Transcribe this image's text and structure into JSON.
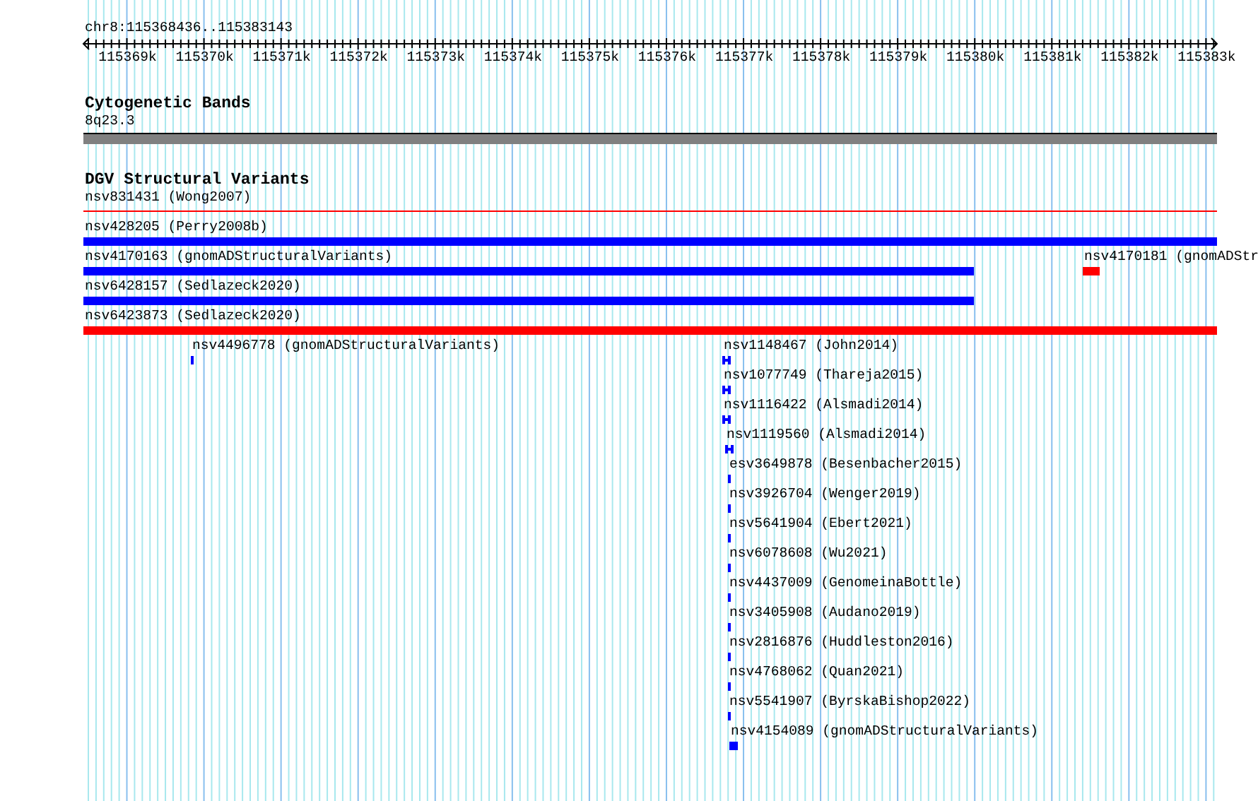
{
  "ruler": {
    "title": "chr8:115368436..115383143",
    "ticks": [
      "115369k",
      "115370k",
      "115371k",
      "115372k",
      "115373k",
      "115374k",
      "115375k",
      "115376k",
      "115377k",
      "115378k",
      "115379k",
      "115380k",
      "115381k",
      "115382k",
      "115383k"
    ]
  },
  "tracks": [
    {
      "kind": "cytoband",
      "title": "Cytogenetic Bands",
      "bands": [
        {
          "name": "8q23.3"
        }
      ]
    },
    {
      "kind": "features",
      "title": "DGV Structural Variants",
      "features": [
        {
          "label": "nsv831431 (Wong2007)",
          "kind": "line",
          "color": "#ff0000"
        },
        {
          "label": "nsv428205 (Perry2008b)",
          "kind": "bar",
          "color": "#0000ff"
        },
        {
          "label": "nsv4170163 (gnomADStructuralVariants)",
          "kind": "bar",
          "color": "#0000ff"
        },
        {
          "label": "nsv4170181 (gnomADStr",
          "kind": "bar",
          "color": "#ff0000"
        },
        {
          "label": "nsv6428157 (Sedlazeck2020)",
          "kind": "bar",
          "color": "#0000ff"
        },
        {
          "label": "nsv6423873 (Sedlazeck2020)",
          "kind": "bar",
          "color": "#ff0000"
        },
        {
          "label": "nsv4496778 (gnomADStructuralVariants)",
          "kind": "bar",
          "color": "#0000ff"
        },
        {
          "label": "nsv1148467 (John2014)",
          "kind": "capped",
          "color": "#0000ff"
        },
        {
          "label": "nsv1077749 (Thareja2015)",
          "kind": "capped",
          "color": "#0000ff"
        },
        {
          "label": "nsv1116422 (Alsmadi2014)",
          "kind": "capped",
          "color": "#0000ff"
        },
        {
          "label": "nsv1119560 (Alsmadi2014)",
          "kind": "capped",
          "color": "#0000ff"
        },
        {
          "label": "esv3649878 (Besenbacher2015)",
          "kind": "bar",
          "color": "#0000ff"
        },
        {
          "label": "nsv3926704 (Wenger2019)",
          "kind": "bar",
          "color": "#0000ff"
        },
        {
          "label": "nsv5641904 (Ebert2021)",
          "kind": "bar",
          "color": "#0000ff"
        },
        {
          "label": "nsv6078608 (Wu2021)",
          "kind": "bar",
          "color": "#0000ff"
        },
        {
          "label": "nsv4437009 (GenomeinaBottle)",
          "kind": "bar",
          "color": "#0000ff"
        },
        {
          "label": "nsv3405908 (Audano2019)",
          "kind": "bar",
          "color": "#0000ff"
        },
        {
          "label": "nsv2816876 (Huddleston2016)",
          "kind": "bar",
          "color": "#0000ff"
        },
        {
          "label": "nsv4768062 (Quan2021)",
          "kind": "bar",
          "color": "#0000ff"
        },
        {
          "label": "nsv5541907 (ByrskaBishop2022)",
          "kind": "bar",
          "color": "#0000ff"
        },
        {
          "label": "nsv4154089 (gnomADStructuralVariants)",
          "kind": "bar",
          "color": "#0000ff"
        }
      ]
    }
  ]
}
